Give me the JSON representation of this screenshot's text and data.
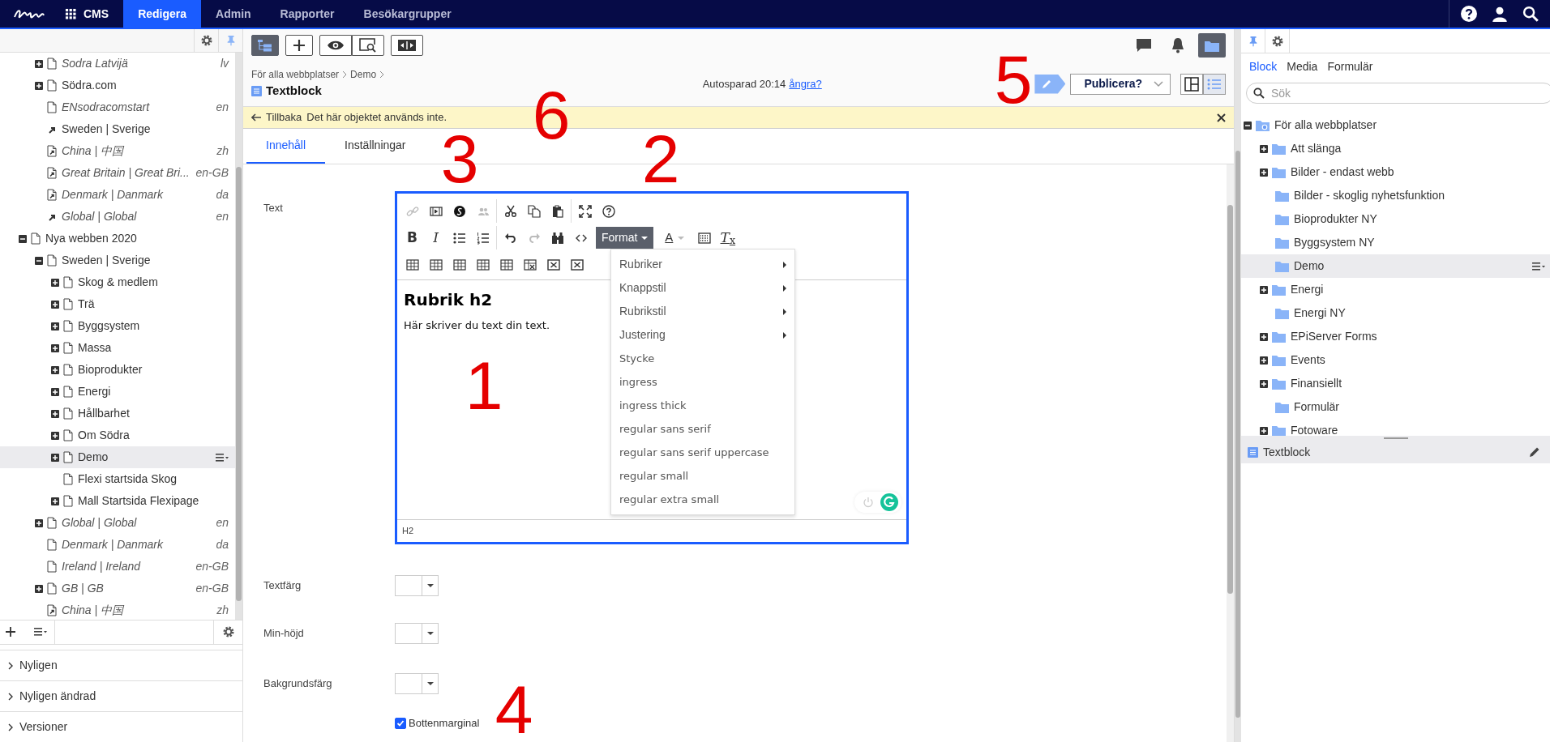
{
  "top_nav": {
    "app": "CMS",
    "tabs": [
      {
        "label": "Redigera",
        "selected": true
      },
      {
        "label": "Admin",
        "selected": false
      },
      {
        "label": "Rapporter",
        "selected": false
      },
      {
        "label": "Besökargrupper",
        "selected": false
      }
    ]
  },
  "left_panel": {
    "tree": [
      {
        "children": [
          {
            "label": "Sodra Latvijä",
            "lang": "lv",
            "kind": "page",
            "italic": true,
            "expanded": false,
            "selected": false
          },
          {
            "label": "Södra.com",
            "kind": "page",
            "italic": false,
            "expanded": false,
            "selected": false
          },
          {
            "label": "ENsodracomstart",
            "lang": "en",
            "kind": "page",
            "italic": true,
            "selected": false
          },
          {
            "label": "Sweden | Sverige",
            "kind": "shortcut",
            "italic": false,
            "selected": false
          },
          {
            "label": "China | 中国",
            "lang": "zh",
            "kind": "link",
            "italic": true,
            "selected": false
          },
          {
            "label": "Great Britain | Great Bri...",
            "lang": "en-GB",
            "kind": "link",
            "italic": true,
            "selected": false
          },
          {
            "label": "Denmark | Danmark",
            "lang": "da",
            "kind": "link",
            "italic": true,
            "selected": false
          },
          {
            "label": "Global | Global",
            "lang": "en",
            "kind": "shortcut",
            "italic": true,
            "selected": false
          }
        ]
      },
      {
        "label": "Nya webben 2020",
        "kind": "page",
        "italic": false,
        "expanded": true,
        "selected": false,
        "children": [
          {
            "label": "Sweden | Sverige",
            "kind": "page",
            "italic": false,
            "expanded": true,
            "selected": false,
            "children": [
              {
                "label": "Skog & medlem",
                "kind": "page",
                "italic": false,
                "expanded": false,
                "selected": false
              },
              {
                "label": "Trä",
                "kind": "page",
                "italic": false,
                "expanded": false,
                "selected": false
              },
              {
                "label": "Byggsystem",
                "kind": "page",
                "italic": false,
                "expanded": false,
                "selected": false
              },
              {
                "label": "Massa",
                "kind": "page",
                "italic": false,
                "expanded": false,
                "selected": false
              },
              {
                "label": "Bioprodukter",
                "kind": "page",
                "italic": false,
                "expanded": false,
                "selected": false
              },
              {
                "label": "Energi",
                "kind": "page",
                "italic": false,
                "expanded": false,
                "selected": false
              },
              {
                "label": "Hållbarhet",
                "kind": "page",
                "italic": false,
                "expanded": false,
                "selected": false
              },
              {
                "label": "Om Södra",
                "kind": "page",
                "italic": false,
                "expanded": false,
                "selected": false
              },
              {
                "label": "Demo",
                "kind": "page",
                "italic": false,
                "expanded": false,
                "selected": true
              },
              {
                "label": "Flexi startsida Skog",
                "kind": "page",
                "italic": false,
                "selected": false
              },
              {
                "label": "Mall Startsida Flexipage",
                "kind": "page",
                "italic": false,
                "expanded": false,
                "selected": false
              }
            ]
          },
          {
            "label": "Global | Global",
            "lang": "en",
            "kind": "page",
            "italic": true,
            "expanded": false,
            "selected": false
          },
          {
            "label": "Denmark | Danmark",
            "lang": "da",
            "kind": "page",
            "italic": true,
            "selected": false
          },
          {
            "label": "Ireland | Ireland",
            "lang": "en-GB",
            "kind": "page",
            "italic": true,
            "selected": false
          },
          {
            "label": "GB | GB",
            "lang": "en-GB",
            "kind": "page",
            "italic": true,
            "expanded": false,
            "selected": false
          },
          {
            "label": "China | 中国",
            "lang": "zh",
            "kind": "link",
            "italic": true,
            "selected": false
          }
        ]
      }
    ],
    "sections": [
      {
        "label": "Nyligen",
        "expanded": false
      },
      {
        "label": "Nyligen ändrad",
        "expanded": false
      },
      {
        "label": "Versioner",
        "expanded": false
      }
    ]
  },
  "toolbar": {
    "left": [
      {
        "kind": "tree",
        "selected": true
      },
      {
        "kind": "add",
        "selected": false
      },
      {
        "kind": "view",
        "selected": false
      },
      {
        "kind": "preview",
        "selected": false
      },
      {
        "kind": "compare",
        "selected": false
      }
    ],
    "right": [
      {
        "kind": "comment",
        "selected": false
      },
      {
        "kind": "bell",
        "selected": false
      },
      {
        "kind": "folder",
        "selected": true
      }
    ]
  },
  "header": {
    "breadcrumb": [
      "För alla webbplatser",
      "Demo"
    ],
    "title": "Textblock",
    "autosave": "Autosparad 20:14",
    "undo_link": "ångra?",
    "publish": "Publicera?",
    "views": [
      {
        "kind": "columns",
        "selected": false
      },
      {
        "kind": "list",
        "selected": true
      }
    ]
  },
  "notice": {
    "back_link": "Tillbaka",
    "message": "Det här objektet används inte."
  },
  "tabs": [
    {
      "label": "Innehåll",
      "selected": true
    },
    {
      "label": "Inställningar",
      "selected": false
    }
  ],
  "form": {
    "editor": {
      "label": "Text",
      "toolbar_rows": [
        [
          [
            {
              "kind": "link",
              "disabled": true
            },
            {
              "kind": "media",
              "disabled": false
            },
            {
              "kind": "embed",
              "disabled": false
            },
            {
              "kind": "people",
              "disabled": true
            }
          ],
          [
            {
              "kind": "cut",
              "disabled": false
            },
            {
              "kind": "copy",
              "disabled": false
            },
            {
              "kind": "paste",
              "disabled": false
            }
          ],
          [
            {
              "kind": "fullscreen",
              "disabled": false
            },
            {
              "kind": "help",
              "disabled": false
            }
          ]
        ],
        [
          [
            {
              "kind": "bold",
              "label": "B",
              "disabled": false
            },
            {
              "kind": "italic",
              "label": "I",
              "disabled": false
            },
            {
              "kind": "bullets",
              "disabled": false
            },
            {
              "kind": "numbers",
              "disabled": false
            }
          ],
          [
            {
              "kind": "undo",
              "disabled": false
            },
            {
              "kind": "redo",
              "disabled": true
            },
            {
              "kind": "find",
              "disabled": false
            },
            {
              "kind": "code",
              "disabled": false
            },
            {
              "kind": "format",
              "label": "Format",
              "disabled": false
            },
            {
              "kind": "fontcolor",
              "label": "A",
              "disabled": false
            },
            {
              "kind": "grid",
              "disabled": false
            },
            {
              "kind": "clear",
              "label": "*T*$_{x}$",
              "disabled": false
            }
          ]
        ],
        [
          [
            {
              "kind": "table",
              "disabled": false
            },
            {
              "kind": "table",
              "disabled": false
            },
            {
              "kind": "table",
              "disabled": false
            },
            {
              "kind": "table",
              "disabled": false
            },
            {
              "kind": "table",
              "disabled": false
            },
            {
              "kind": "table-x",
              "disabled": false
            },
            {
              "kind": "cell-x",
              "disabled": false
            },
            {
              "kind": "cell-x",
              "disabled": false
            }
          ]
        ]
      ],
      "heading": "Rubrik h2",
      "paragraph": "Här skriver du text din text.",
      "path": "H2",
      "format_menu": [
        {
          "label": "Rubriker",
          "submenu": true
        },
        {
          "label": "Knappstil",
          "submenu": true
        },
        {
          "label": "Rubrikstil",
          "submenu": true
        },
        {
          "label": "Justering",
          "submenu": true
        },
        {
          "label": "Stycke",
          "submenu": false
        },
        {
          "label": "ingress",
          "submenu": false
        },
        {
          "label": "ingress thick",
          "submenu": false
        },
        {
          "label": "regular sans serif",
          "submenu": false
        },
        {
          "label": "regular sans serif uppercase",
          "submenu": false
        },
        {
          "label": "regular small",
          "submenu": false
        },
        {
          "label": "regular extra small",
          "submenu": false
        }
      ]
    },
    "dropdowns": [
      {
        "label": "Textfärg"
      },
      {
        "label": "Min-höjd"
      },
      {
        "label": "Bakgrundsfärg"
      }
    ],
    "checkbox": {
      "label": "Bottenmarginal",
      "checked": true
    }
  },
  "right_panel": {
    "tabs": [
      {
        "label": "Block",
        "selected": true
      },
      {
        "label": "Media",
        "selected": false
      },
      {
        "label": "Formulär",
        "selected": false
      }
    ],
    "search": {
      "placeholder": "Sök"
    },
    "tree": [
      {
        "label": "För alla webbplatser",
        "expanded": true,
        "selected": false,
        "children": [
          {
            "label": "Att slänga",
            "expanded": false,
            "selected": false
          },
          {
            "label": "Bilder - endast webb",
            "expanded": false,
            "selected": false
          },
          {
            "label": "Bilder - skoglig nyhetsfunktion",
            "selected": false
          },
          {
            "label": "Bioprodukter NY",
            "selected": false
          },
          {
            "label": "Byggsystem NY",
            "selected": false
          },
          {
            "label": "Demo",
            "selected": true
          },
          {
            "label": "Energi",
            "expanded": false,
            "selected": false
          },
          {
            "label": "Energi NY",
            "selected": false
          },
          {
            "label": "EPiServer Forms",
            "expanded": false,
            "selected": false
          },
          {
            "label": "Events",
            "expanded": false,
            "selected": false
          },
          {
            "label": "Finansiellt",
            "expanded": false,
            "selected": false
          },
          {
            "label": "Formulär",
            "selected": false
          },
          {
            "label": "Fotoware",
            "expanded": false,
            "selected": false
          }
        ]
      }
    ],
    "content": [
      {
        "title": "Textblock"
      }
    ]
  },
  "annotations": [
    "1",
    "2",
    "3",
    "4",
    "5",
    "6"
  ]
}
